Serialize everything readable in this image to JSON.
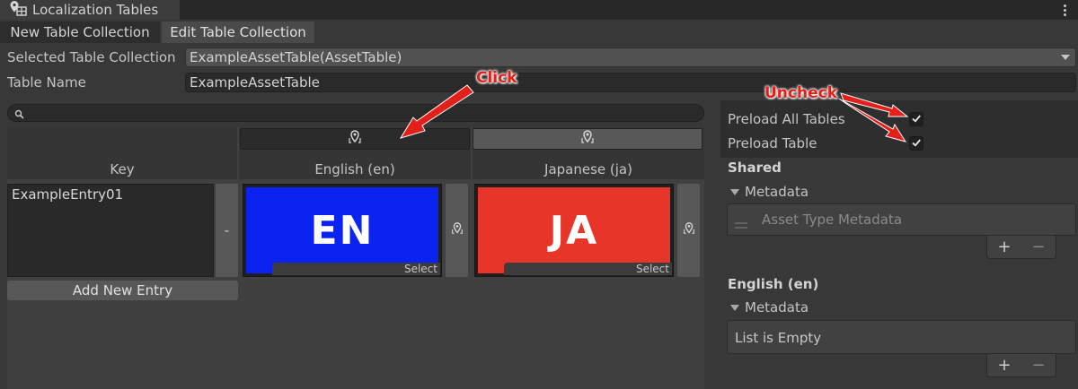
{
  "window": {
    "title": "Localization Tables",
    "title_icon": "map-pin-grid-icon",
    "menu_icon": "kebab-menu-icon"
  },
  "tabs": [
    {
      "label": "New Table Collection",
      "active": false
    },
    {
      "label": "Edit Table Collection",
      "active": true
    }
  ],
  "form": {
    "collection_label": "Selected Table Collection",
    "collection_value": "ExampleAssetTable(AssetTable)",
    "name_label": "Table Name",
    "name_value": "ExampleAssetTable"
  },
  "search": {
    "icon": "search-icon",
    "value": ""
  },
  "table": {
    "columns": [
      {
        "name": "Key"
      },
      {
        "name": "English (en)",
        "pin_icon": "metadata-pin-icon"
      },
      {
        "name": "Japanese (ja)",
        "pin_icon": "metadata-pin-icon"
      }
    ],
    "rows": [
      {
        "key": "ExampleEntry01",
        "remove_label": "-",
        "cells": [
          {
            "text": "EN",
            "color": "#0a23f0",
            "select_label": "Select"
          },
          {
            "text": "JA",
            "color": "#e8352a",
            "select_label": "Select"
          }
        ]
      }
    ],
    "add_entry_label": "Add New Entry"
  },
  "panel": {
    "preload_all_label": "Preload All Tables",
    "preload_all_checked": true,
    "preload_table_label": "Preload Table",
    "preload_table_checked": true,
    "shared": {
      "header": "Shared",
      "metadata_label": "Metadata",
      "items": [
        "Asset Type Metadata"
      ],
      "add_label": "+",
      "remove_label": "−"
    },
    "english": {
      "header": "English (en)",
      "metadata_label": "Metadata",
      "empty_text": "List is Empty",
      "add_label": "+",
      "remove_label": "−"
    }
  },
  "annotations": {
    "click": "Click",
    "uncheck": "Uncheck",
    "color": "#e22019"
  }
}
